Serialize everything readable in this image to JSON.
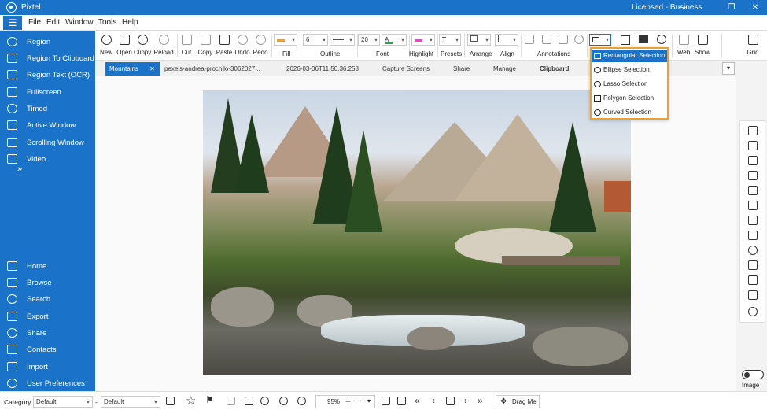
{
  "titlebar": {
    "app_name": "Pixtel",
    "license": "Licensed - Business",
    "minimize": "—",
    "restore": "❐",
    "close": "✕"
  },
  "menu": {
    "hamburger": "☰",
    "items": [
      "File",
      "Edit",
      "Window",
      "Tools",
      "Help"
    ]
  },
  "sidebar": {
    "top_items": [
      "Region",
      "Region To Clipboard",
      "Region Text (OCR)",
      "Fullscreen",
      "Timed",
      "Active Window",
      "Scrolling Window",
      "Video"
    ],
    "more": "»",
    "bottom_items": [
      "Home",
      "Browse",
      "Search",
      "Export",
      "Share",
      "Contacts",
      "Import",
      "User Preferences"
    ]
  },
  "ribbon": {
    "buttons": [
      "New",
      "Open",
      "Clippy",
      "Reload",
      "Cut",
      "Copy",
      "Paste",
      "Undo",
      "Redo"
    ],
    "fill_label": "Fill",
    "outline_label": "Outline",
    "outline_width": "6",
    "font_label": "Font",
    "font_size": "20",
    "highlight_label": "Highlight",
    "presets_label": "Presets",
    "arrange_label": "Arrange",
    "align_label": "Align",
    "annotations_label": "Annotations",
    "web_label": "Web",
    "show_label": "Show",
    "grid_label": "Grid",
    "fill_color": "#e8a13a",
    "font_color": "#2e9e4f",
    "highlight_color": "#d64fc6"
  },
  "tabs": {
    "active": "Mountains",
    "close": "✕",
    "items": [
      "pexels-andrea-prochilo-3062027...",
      "2026-03-06T11.50.36.258",
      "Capture Screens",
      "Share",
      "Manage",
      "Clipboard"
    ],
    "dropdown": "▾"
  },
  "selection_menu": {
    "items": [
      "Rectangular Selection",
      "Ellipse Selection",
      "Lasso Selection",
      "Polygon Selection",
      "Curved Selection"
    ],
    "selected": "Rectangular Selection"
  },
  "right_panel": {
    "image_label": "Image"
  },
  "statusbar": {
    "category_label": "Category",
    "category_value": "Default",
    "separator": "-",
    "preset_value": "Default",
    "zoom": "95%",
    "zoom_plus": "+",
    "zoom_minus": "—",
    "drag_label": "Drag Me",
    "drag_icon": "✥"
  },
  "accent_color": "#1a73c8"
}
